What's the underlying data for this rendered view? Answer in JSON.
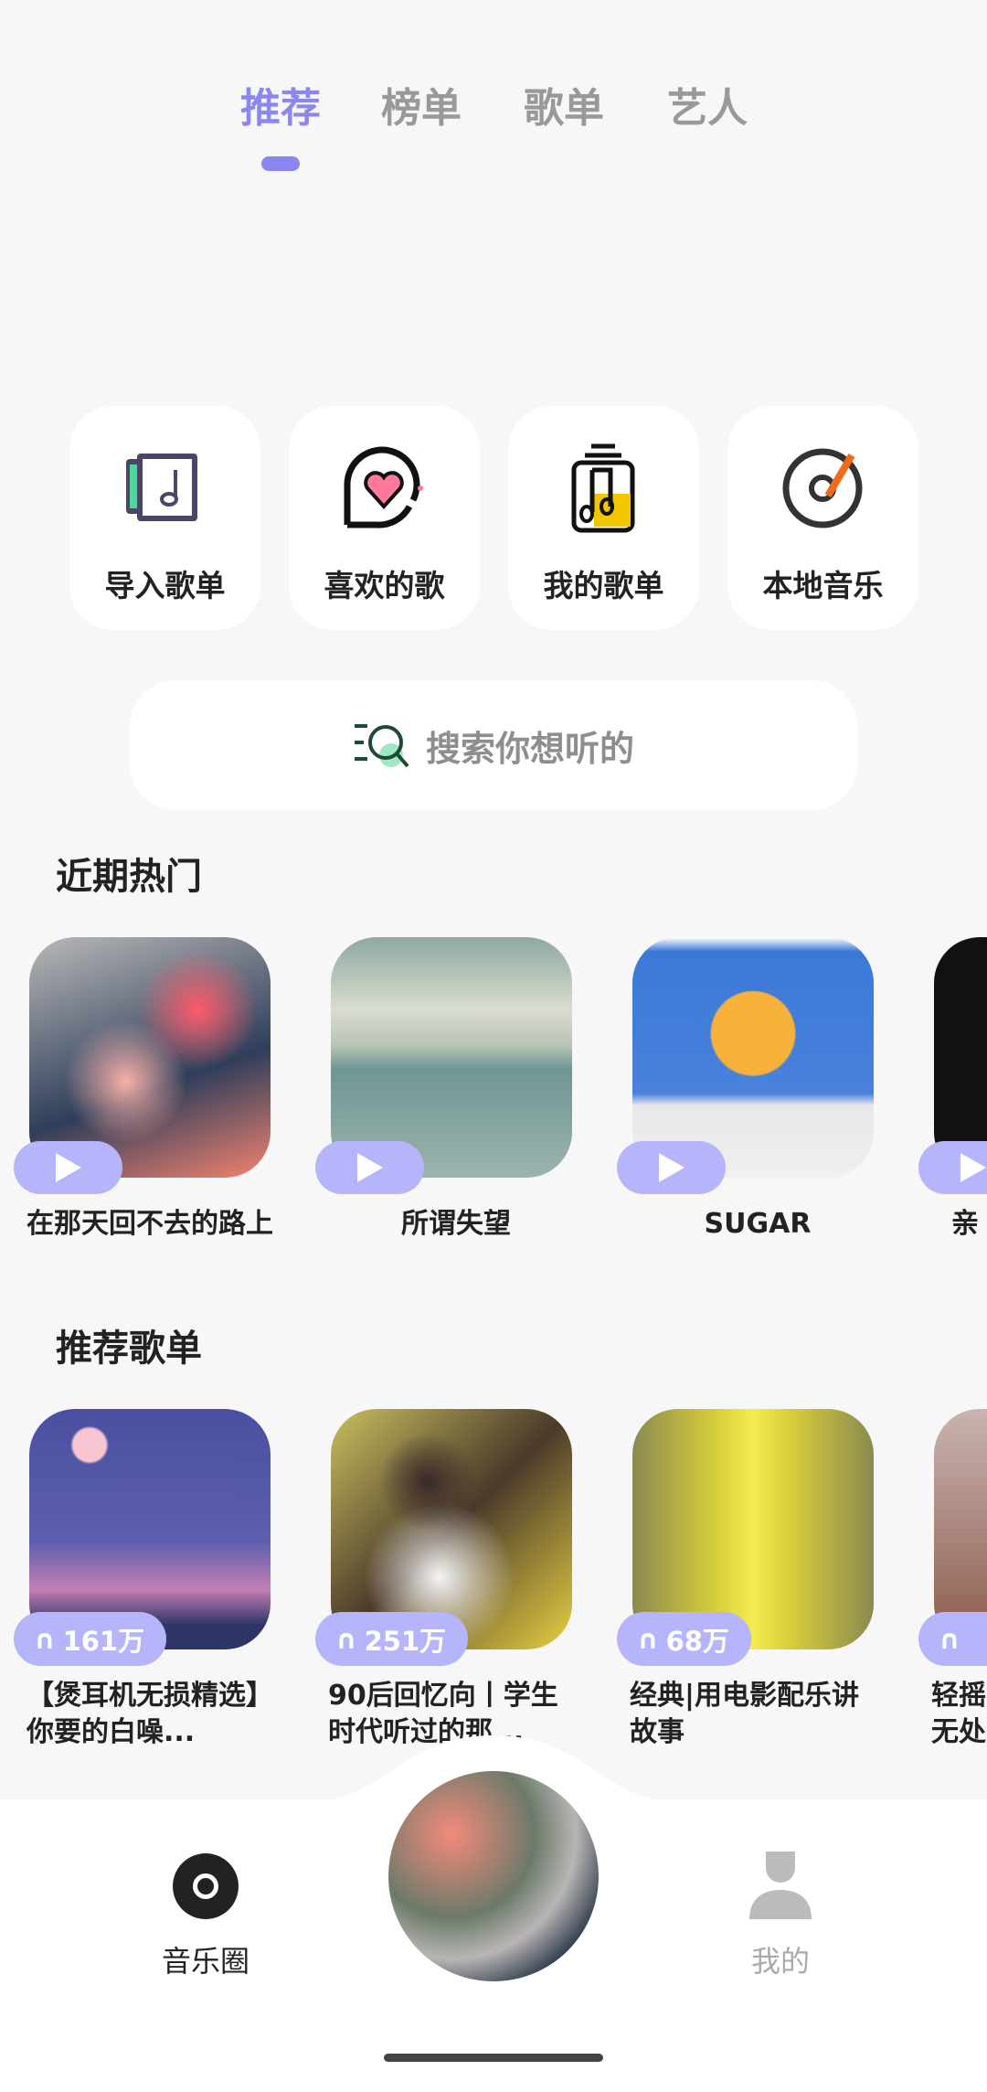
{
  "tabs": [
    {
      "label": "推荐",
      "active": true
    },
    {
      "label": "榜单"
    },
    {
      "label": "歌单"
    },
    {
      "label": "艺人"
    }
  ],
  "accent_color": "#8b86f2",
  "badge_color": "#b6b5fb",
  "quick_actions": [
    {
      "label": "导入歌单",
      "icon": "import-playlist-icon"
    },
    {
      "label": "喜欢的歌",
      "icon": "heart-bubble-icon"
    },
    {
      "label": "我的歌单",
      "icon": "music-jar-icon"
    },
    {
      "label": "本地音乐",
      "icon": "vinyl-disc-icon"
    }
  ],
  "search": {
    "placeholder": "搜索你想听的",
    "icon": "search-icon"
  },
  "recent_hot": {
    "title": "近期热门",
    "items": [
      {
        "title": "在那天回不去的路上"
      },
      {
        "title": "所谓失望"
      },
      {
        "title": "SUGAR"
      },
      {
        "title": "亲"
      }
    ]
  },
  "recommended_playlists": {
    "title": "推荐歌单",
    "items": [
      {
        "title": "【煲耳机无损精选】你要的白噪...",
        "plays": "161万"
      },
      {
        "title": "90后回忆向丨学生时代听过的那...",
        "plays": "251万"
      },
      {
        "title": "经典|用电影配乐讲故事",
        "plays": "68万"
      },
      {
        "title": "轻摇无处",
        "plays": ""
      }
    ]
  },
  "bottom_nav": [
    {
      "label": "音乐圈",
      "icon": "music-circle-icon"
    },
    {
      "label": "我的",
      "icon": "profile-icon"
    }
  ]
}
